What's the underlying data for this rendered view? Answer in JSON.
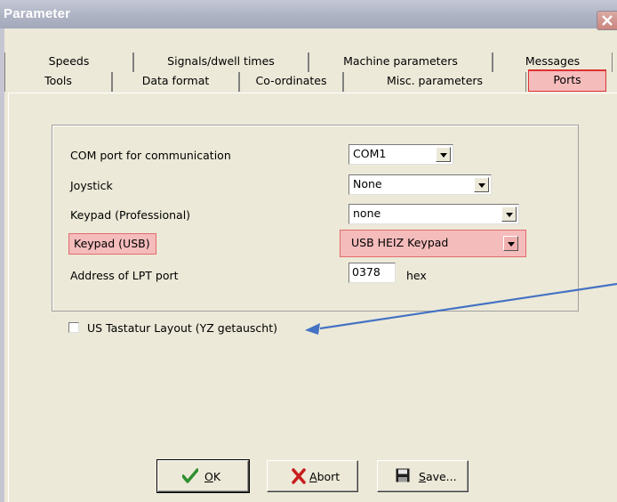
{
  "window": {
    "title": "Parameter"
  },
  "tabs": {
    "row1": [
      "Speeds",
      "Signals/dwell times",
      "Machine parameters",
      "Messages"
    ],
    "row2": [
      "Tools",
      "Data format",
      "Co-ordinates",
      "Misc. parameters",
      "Ports"
    ],
    "selected": "Ports"
  },
  "form": {
    "com_port": {
      "label": "COM port for communication",
      "value": "COM1"
    },
    "joystick": {
      "label": "Joystick",
      "value": "None"
    },
    "keypad_pro": {
      "label": "Keypad (Professional)",
      "value": "none"
    },
    "keypad_usb": {
      "label": "Keypad (USB)",
      "value": "USB HEIZ Keypad"
    },
    "lpt": {
      "label": "Address of LPT port",
      "value": "0378",
      "unit": "hex"
    },
    "us_layout": {
      "label": "US Tastatur Layout (YZ getauscht)",
      "checked": false
    }
  },
  "buttons": {
    "ok": {
      "accel": "O",
      "rest": "K"
    },
    "abort": {
      "accel": "A",
      "rest": "bort"
    },
    "save": {
      "accel": "S",
      "rest": "ave..."
    }
  },
  "annotations": {
    "arrow_color": "#4472c4",
    "highlight_color": "#f5bcbc"
  },
  "icons": {
    "ok": "check-icon",
    "abort": "x-icon",
    "save": "floppy-disk-icon",
    "close": "close-icon"
  }
}
